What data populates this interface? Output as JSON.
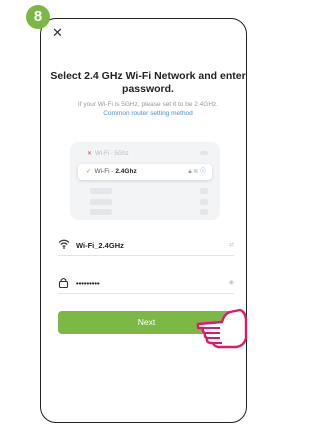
{
  "step_badge": "8",
  "close": "✕",
  "title": "Select 2.4 GHz Wi-Fi Network and enter password.",
  "hint": "If your Wi-Fi is 5GHz, please set it to be 2.4GHz.",
  "hint_link": "Common router setting method",
  "illustration": {
    "row_5g": "Wi-Fi - 5Ghz",
    "row_24_prefix": "Wi-Fi - ",
    "row_24_name": "2.4Ghz"
  },
  "wifi": {
    "value": "Wi-Fi_2.4GHz",
    "right_icon": "switch-icon"
  },
  "password": {
    "value": "•••••••••",
    "right_icon": "eye-icon"
  },
  "next_label": "Next",
  "colors": {
    "accent": "#7cb944",
    "link": "#4a8fe0",
    "error": "#e04848"
  }
}
